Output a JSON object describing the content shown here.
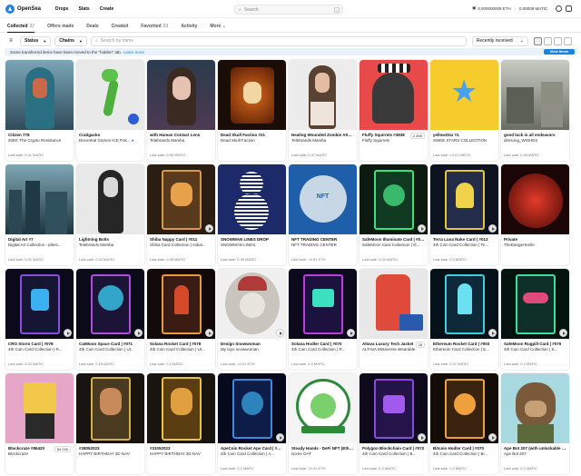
{
  "header": {
    "logo_text": "OpenSea",
    "nav": [
      "Drops",
      "Stats",
      "Create"
    ],
    "search_placeholder": "Search",
    "search_shortcut": "/",
    "wallet_eth": "0.000000009 ETH",
    "wallet_matic": "0.00008 MATIC"
  },
  "tabs": [
    {
      "label": "Collected",
      "count": "37"
    },
    {
      "label": "Offers made",
      "count": ""
    },
    {
      "label": "Deals",
      "count": ""
    },
    {
      "label": "Created",
      "count": ""
    },
    {
      "label": "Favorited",
      "count": "63"
    },
    {
      "label": "Activity",
      "count": ""
    },
    {
      "label": "More",
      "count": ""
    }
  ],
  "filters": {
    "status_label": "Status",
    "chains_label": "Chains",
    "search_placeholder": "Search by name",
    "sort_label": "Recently received"
  },
  "notice": {
    "text": "Some transferred items have been moved to the \"hidden\" tab.",
    "link": "Learn more",
    "button": "View items"
  },
  "cards": [
    {
      "name": "Citizen 778",
      "collection": "2050: The Crypto Resistance",
      "last": "Last sale: 0.01 MATIC",
      "verified": false,
      "badge": "",
      "play": false,
      "art": "hooded"
    },
    {
      "name": "Cratigacko",
      "collection": "Decentral Games ICE Pok...",
      "last": "",
      "verified": true,
      "badge": "",
      "play": false,
      "art": "gecko"
    },
    {
      "name": "with Human Contact Lens",
      "collection": "Telebrands Mamba",
      "last": "Last sale: 0.05 MATIC",
      "verified": false,
      "badge": "",
      "play": false,
      "art": "girl"
    },
    {
      "name": "Dead Skull Faction #21",
      "collection": "Dead Skull Faction",
      "last": "",
      "verified": false,
      "badge": "",
      "play": false,
      "art": "skull"
    },
    {
      "name": "Healing Wounded Zombie Attack",
      "collection": "Telebrands Mamba",
      "last": "Last sale: 0.47 MATIC",
      "verified": false,
      "badge": "",
      "play": false,
      "art": "zombie"
    },
    {
      "name": "Fluffy Squirrels #3838",
      "collection": "Fluffy Squirrels",
      "last": "",
      "verified": false,
      "badge": "2 806",
      "play": false,
      "art": "squirrel"
    },
    {
      "name": "yellowStar #1",
      "collection": "SWEE STARS COLLECTION",
      "last": "Last sale: <0.01 MATIC",
      "verified": false,
      "badge": "",
      "play": false,
      "art": "star"
    },
    {
      "name": "good luck in all endeavors",
      "collection": "dimsong_WISHES",
      "last": "Last sale: 0.05 MATIC",
      "verified": false,
      "badge": "",
      "play": false,
      "art": "street"
    },
    {
      "name": "Digital Art #7",
      "collection": "Digital Art Collection - pikes...",
      "last": "Last sale: 0.01 MATIC",
      "verified": false,
      "badge": "",
      "play": false,
      "art": "city"
    },
    {
      "name": "Lightning Bolts",
      "collection": "Telebrands Mamba",
      "last": "Last sale: 0.02 MATIC",
      "verified": false,
      "badge": "",
      "play": false,
      "art": "bw"
    },
    {
      "name": "Shiba Nappy Card | #011",
      "collection": "Shiba Card Collection | Initial...",
      "last": "Last sale: 0.05 MATIC",
      "verified": false,
      "badge": "",
      "play": true,
      "art": "shiba"
    },
    {
      "name": "SNOWMAN LINES DROP",
      "collection": "SNOWMAN LINES",
      "last": "Last sale: 0.49 MATIC",
      "verified": false,
      "badge": "",
      "play": false,
      "art": "snowman"
    },
    {
      "name": "NFT TRADING CENTER",
      "collection": "NFT TRADING CENTER",
      "last": "Last sale: <0.01 ETH",
      "verified": false,
      "badge": "",
      "play": false,
      "art": "trading"
    },
    {
      "name": "SafeMoon Illuminate Card | #020",
      "collection": "SafeMoon Card Collection | Ill...",
      "last": "Last sale: 0.24 MATIC",
      "verified": false,
      "badge": "",
      "play": true,
      "art": "greencard"
    },
    {
      "name": "Terra Luna Nuke Card | #013",
      "collection": "4th Coin Card Collection | Te...",
      "last": "Last sale: 0.2 MATIC",
      "verified": false,
      "badge": "",
      "play": true,
      "art": "nuke"
    },
    {
      "name": "Private",
      "collection": "TheDangerSmile",
      "last": "",
      "verified": false,
      "badge": "",
      "play": false,
      "art": "red"
    },
    {
      "name": "CRO Storm Card | #078",
      "collection": "4th Coin Card Collection | R...",
      "last": "Last sale: 0.02 MATIC",
      "verified": false,
      "badge": "",
      "play": true,
      "art": "cro"
    },
    {
      "name": "CatMoon Space Card | #071",
      "collection": "4th Coin Card Collection | Ut...",
      "last": "Last sale: 0.15 MATIC",
      "verified": false,
      "badge": "",
      "play": true,
      "art": "catmoon"
    },
    {
      "name": "Solana Rocket Card | #078",
      "collection": "4th Coin Card Collection | Ut...",
      "last": "Last sale: 0.2 MATIC",
      "verified": false,
      "badge": "",
      "play": true,
      "art": "solana"
    },
    {
      "name": "Design Snowwoman",
      "collection": "My toys snowwoman",
      "last": "Last sale: <0.01 ETH",
      "verified": false,
      "badge": "",
      "play": true,
      "art": "snowwoman"
    },
    {
      "name": "Solana Hodler Card | #070",
      "collection": "4th Coin Card Collection | R...",
      "last": "Last sale: 0.2 MATIC",
      "verified": false,
      "badge": "",
      "play": true,
      "art": "solhodl"
    },
    {
      "name": "Altava Luxury Tech Jacket",
      "collection": "ALTAVA Metaverse Wearable",
      "last": "",
      "verified": false,
      "badge": "28",
      "play": false,
      "art": "jacket"
    },
    {
      "name": "Ethereum Rocket Card | #003",
      "collection": "Ethereum Card Collection | E...",
      "last": "Last sale: 0.07 MATIC",
      "verified": false,
      "badge": "",
      "play": true,
      "art": "ethrocket"
    },
    {
      "name": "SafeMoon Rugpill Card | #070",
      "collection": "4th Coin Card Collection | S...",
      "last": "Last sale: 0.2 MATIC",
      "verified": false,
      "badge": "",
      "play": true,
      "art": "rugpill"
    },
    {
      "name": "Blockcraze #86420",
      "collection": "Blockcraze",
      "last": "",
      "verified": false,
      "badge": "84 026",
      "play": false,
      "art": "blocky"
    },
    {
      "name": "#28052023",
      "collection": "HAPPY BIRTHDAY 3D NAV",
      "last": "",
      "verified": false,
      "badge": "",
      "play": false,
      "art": "bday1"
    },
    {
      "name": "#31052023",
      "collection": "HAPPY BIRTHDAY 3D NAV",
      "last": "",
      "verified": false,
      "badge": "",
      "play": false,
      "art": "bday2"
    },
    {
      "name": "ApeCoin Rocket Ape Card | #074",
      "collection": "4th Coin Card Collection | A...",
      "last": "Last sale: 0.2 MATIC",
      "verified": false,
      "badge": "",
      "play": true,
      "art": "apecoin"
    },
    {
      "name": "Steady Hands - DeFi NFT (Ethereum)",
      "collection": "Some OAT",
      "last": "Last sale: <0.01 ETH",
      "verified": false,
      "badge": "",
      "play": false,
      "art": "steady"
    },
    {
      "name": "Polygon Blockchain Card | #072",
      "collection": "4th Coin Card Collection | B...",
      "last": "Last sale: 0.2 MATIC",
      "verified": false,
      "badge": "",
      "play": true,
      "art": "polygon"
    },
    {
      "name": "Bitcoin Hodler Card | #070",
      "collection": "4th Coin Card Collection | Bi...",
      "last": "Last sale: 0.2 MATIC",
      "verified": false,
      "badge": "",
      "play": true,
      "art": "bitcoin"
    },
    {
      "name": "Ape Bot 207 (with unlockable con...",
      "collection": "Ape Bot 207",
      "last": "Last sale: 0.2 MATIC",
      "verified": false,
      "badge": "",
      "play": false,
      "art": "ape"
    }
  ]
}
